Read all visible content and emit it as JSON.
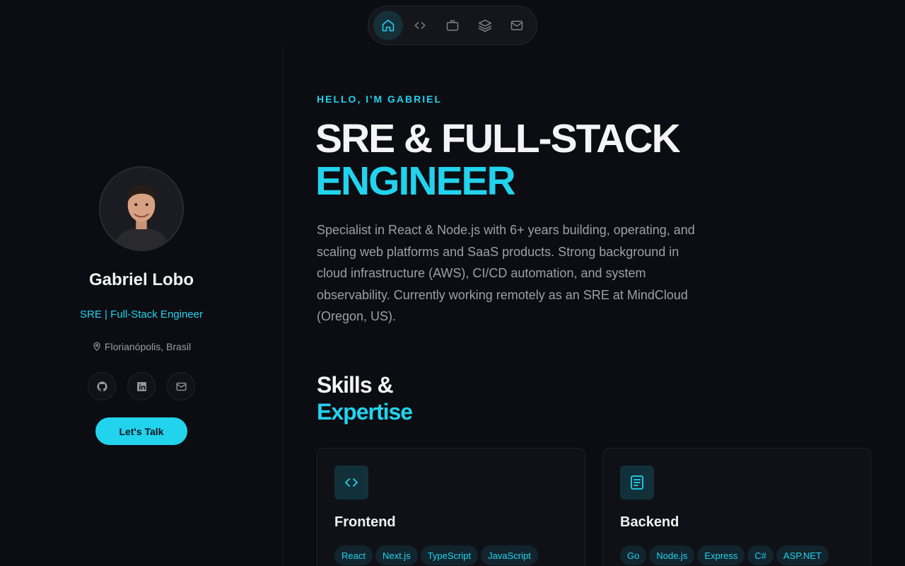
{
  "nav": {
    "items": [
      {
        "id": "home",
        "icon": "home-icon",
        "active": true
      },
      {
        "id": "code",
        "icon": "code-icon",
        "active": false
      },
      {
        "id": "work",
        "icon": "briefcase-icon",
        "active": false
      },
      {
        "id": "stack",
        "icon": "layers-icon",
        "active": false
      },
      {
        "id": "contact",
        "icon": "mail-icon",
        "active": false
      }
    ]
  },
  "profile": {
    "name": "Gabriel Lobo",
    "role": "SRE | Full-Stack Engineer",
    "location": "Florianópolis, Brasil",
    "socials": [
      {
        "id": "github",
        "icon": "github-icon"
      },
      {
        "id": "linkedin",
        "icon": "linkedin-icon"
      },
      {
        "id": "email",
        "icon": "mail-icon"
      }
    ],
    "cta_label": "Let's Talk"
  },
  "hero": {
    "greeting": "HELLO, I'M GABRIEL",
    "title_line1": "SRE & FULL-STACK",
    "title_line2": "ENGINEER",
    "description": "Specialist in React & Node.js with 6+ years building, operating, and scaling web platforms and SaaS products. Strong background in cloud infrastructure (AWS), CI/CD automation, and system observability. Currently working remotely as an SRE at MindCloud (Oregon, US)."
  },
  "skills": {
    "title_line1": "Skills &",
    "title_line2": "Expertise",
    "cards": [
      {
        "title": "Frontend",
        "icon": "code-icon",
        "tags": [
          "React",
          "Next.js",
          "TypeScript",
          "JavaScript"
        ]
      },
      {
        "title": "Backend",
        "icon": "document-icon",
        "tags": [
          "Go",
          "Node.js",
          "Express",
          "C#",
          "ASP.NET"
        ]
      }
    ]
  },
  "colors": {
    "accent": "#22d3ee",
    "background": "#0c0d12",
    "card": "#101117",
    "muted_text": "#9d9fa9"
  }
}
